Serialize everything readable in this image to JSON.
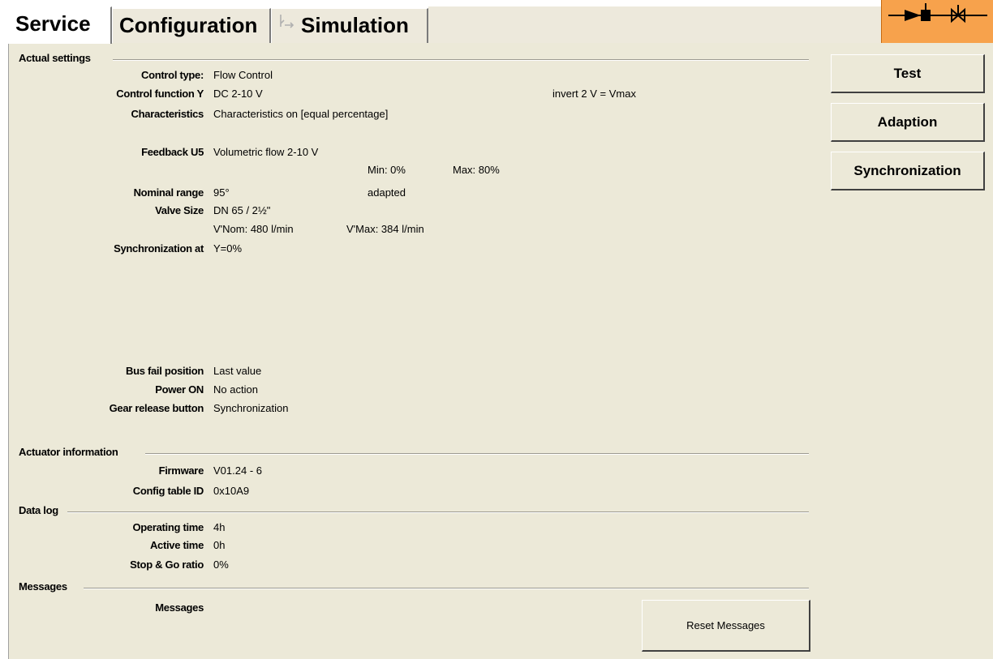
{
  "tabs": [
    {
      "label": "Service"
    },
    {
      "label": "Configuration"
    },
    {
      "label": "Simulation"
    }
  ],
  "sections": {
    "actual_settings": "Actual settings",
    "actuator_information": "Actuator information",
    "data_log": "Data log",
    "messages": "Messages"
  },
  "settings": {
    "control_type": {
      "label": "Control type:",
      "value": "Flow Control"
    },
    "control_function": {
      "label": "Control function Y",
      "value": "DC 2-10 V",
      "extra": "invert 2 V = Vmax"
    },
    "characteristics": {
      "label": "Characteristics",
      "value": "Characteristics on [equal percentage]"
    },
    "feedback": {
      "label": "Feedback U5",
      "value": "Volumetric flow 2-10 V",
      "min": "Min: 0%",
      "max": "Max: 80%"
    },
    "nominal_range": {
      "label": "Nominal range",
      "value": "95°",
      "extra": "adapted"
    },
    "valve_size": {
      "label": "Valve Size",
      "value": "DN 65 / 2½\"",
      "vnom": "V'Nom: 480 l/min",
      "vmax": "V'Max: 384 l/min"
    },
    "synchronization_at": {
      "label": "Synchronization at",
      "value": "Y=0%"
    },
    "bus_fail": {
      "label": "Bus fail position",
      "value": "Last value"
    },
    "power_on": {
      "label": "Power ON",
      "value": "No action"
    },
    "gear_release": {
      "label": "Gear release button",
      "value": "Synchronization"
    }
  },
  "actuator": {
    "firmware": {
      "label": "Firmware",
      "value": "V01.24 - 6"
    },
    "config_table": {
      "label": "Config table ID",
      "value": "0x10A9"
    }
  },
  "datalog": {
    "operating_time": {
      "label": "Operating time",
      "value": "4h"
    },
    "active_time": {
      "label": "Active time",
      "value": "0h"
    },
    "stop_go": {
      "label": "Stop & Go ratio",
      "value": "0%"
    }
  },
  "messages": {
    "label": "Messages",
    "reset_button": "Reset Messages"
  },
  "actions": {
    "test": "Test",
    "adaption": "Adaption",
    "synchronization": "Synchronization"
  },
  "status_icon": "valve-actuator-icon"
}
